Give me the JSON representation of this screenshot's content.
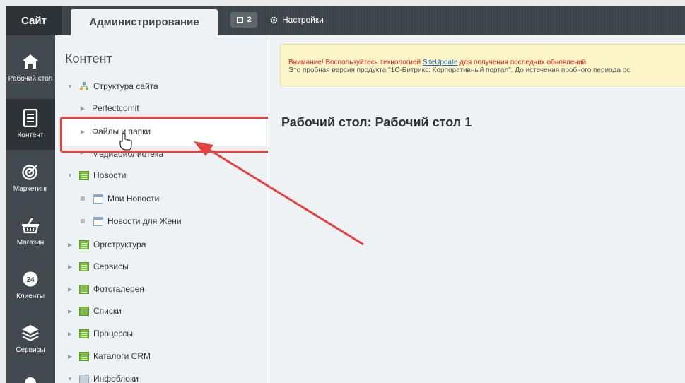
{
  "topbar": {
    "site_tab": "Сайт",
    "admin_tab": "Администрирование",
    "notifications_count": "2",
    "settings_label": "Настройки"
  },
  "leftmenu": {
    "items": [
      {
        "label": "Рабочий стол",
        "icon": "home-icon"
      },
      {
        "label": "Контент",
        "icon": "document-icon",
        "active": true
      },
      {
        "label": "Маркетинг",
        "icon": "target-icon"
      },
      {
        "label": "Магазин",
        "icon": "basket-icon"
      },
      {
        "label": "Клиенты",
        "icon": "clock-24-icon"
      },
      {
        "label": "Сервисы",
        "icon": "layers-icon"
      }
    ]
  },
  "tree": {
    "title": "Контент",
    "items": [
      {
        "label": "Структура сайта",
        "icon": "structure-icon",
        "expanded": true
      },
      {
        "label": "Perfectcomit"
      },
      {
        "label": "Файлы и папки"
      },
      {
        "label": "Медиабиблиотека"
      },
      {
        "label": "Новости",
        "icon": "document-icon",
        "expanded": true
      },
      {
        "label": "Мои Новости",
        "icon": "calendar-icon"
      },
      {
        "label": "Новости для Жени",
        "icon": "calendar-icon"
      },
      {
        "label": "Оргструктура",
        "icon": "document-icon"
      },
      {
        "label": "Сервисы",
        "icon": "document-icon"
      },
      {
        "label": "Фотогалерея",
        "icon": "document-icon"
      },
      {
        "label": "Списки",
        "icon": "document-icon"
      },
      {
        "label": "Процессы",
        "icon": "document-icon"
      },
      {
        "label": "Каталоги CRM",
        "icon": "document-icon"
      },
      {
        "label": "Инфоблоки",
        "icon": "infoblock-icon",
        "expanded": true
      }
    ]
  },
  "alert": {
    "warning_prefix": "Внимание! Воспользуйтесь технологией ",
    "link": "SiteUpdate",
    "warning_suffix": " для получения последних обновлений.",
    "info": "Это пробная версия продукта \"1С-Битрикс: Корпоративный портал\". До истечения пробного периода ос"
  },
  "main": {
    "page_title": "Рабочий стол: Рабочий стол 1"
  },
  "colors": {
    "accent_red": "#e5413f",
    "dark_panel": "#41494e",
    "alert_bg": "#fbf5c8"
  }
}
